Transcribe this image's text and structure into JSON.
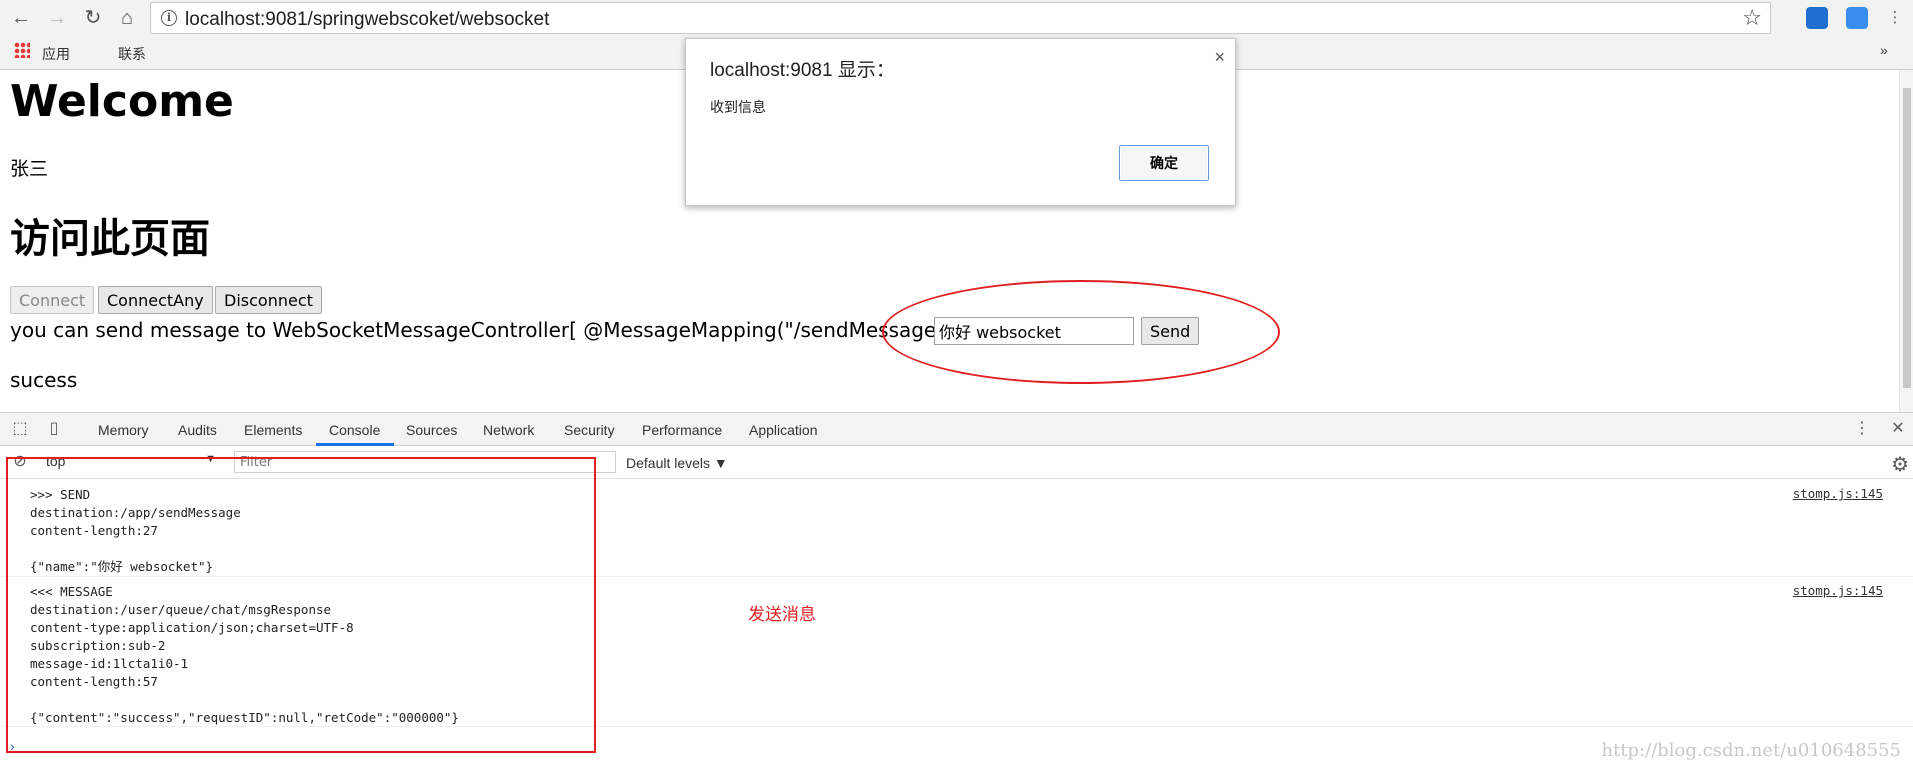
{
  "browser": {
    "url": "localhost:9081/springwebscoket/websocket",
    "bookmarks": [
      "应用",
      "联系"
    ]
  },
  "page": {
    "welcome": "Welcome",
    "user": "张三",
    "heading": "访问此页面",
    "buttons": {
      "connect": "Connect",
      "connect_any": "ConnectAny",
      "disconnect": "Disconnect"
    },
    "send_text": "you can send message to WebSocketMessageController[ @MessageMapping(\"/sendMessage\") ]",
    "message_value": "你好 websocket",
    "send_label": "Send",
    "status": "sucess"
  },
  "alert": {
    "title": "localhost:9081 显示：",
    "message": "收到信息",
    "ok_label": "确定",
    "close": "×"
  },
  "devtools": {
    "tabs": [
      "Memory",
      "Audits",
      "Elements",
      "Console",
      "Sources",
      "Network",
      "Security",
      "Performance",
      "Application"
    ],
    "active_tab": "Console",
    "context": "top",
    "filter_placeholder": "Filter",
    "levels": "Default levels ▼",
    "logs": [
      {
        "text": ">>> SEND\ndestination:/app/sendMessage\ncontent-length:27\n\n{\"name\":\"你好 websocket\"}",
        "source": "stomp.js:145"
      },
      {
        "text": "<<< MESSAGE\ndestination:/user/queue/chat/msgResponse\ncontent-type:application/json;charset=UTF-8\nsubscription:sub-2\nmessage-id:1lcta1i0-1\ncontent-length:57\n\n{\"content\":\"success\",\"requestID\":null,\"retCode\":\"000000\"}",
        "source": "stomp.js:145"
      }
    ],
    "annotation": "发送消息"
  },
  "watermark": "http://blog.csdn.net/u010648555",
  "colors": {
    "annotation_red": "#e02020",
    "active_tab_blue": "#1a73e8"
  }
}
